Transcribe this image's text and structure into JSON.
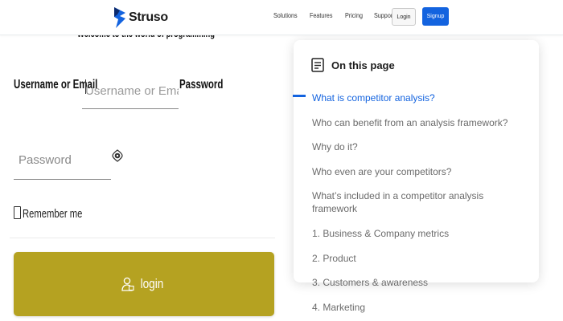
{
  "header": {
    "brand": "Struso",
    "nav": [
      "Solutions",
      "Features",
      "Pricing",
      "Support"
    ],
    "login_label": "Login",
    "signup_label": "Signup",
    "accent": "#1363df"
  },
  "form": {
    "welcome": "Welcome to the world of programming",
    "username_label": "Username or Email",
    "username_placeholder": "Username or Email",
    "password_label": "Password",
    "password_placeholder": "Password",
    "remember_label": "Remember me",
    "login_button": "login",
    "login_button_color": "#b5a221"
  },
  "toc": {
    "title": "On this page",
    "active_index": 0,
    "items": [
      "What is competitor analysis?",
      "Who can benefit from an analysis framework?",
      "Why do it?",
      "Who even are your competitors?",
      "What’s included in a competitor analysis framework",
      "1. Business & Company metrics",
      "2. Product",
      "3. Customers & awareness",
      "4. Marketing"
    ]
  }
}
